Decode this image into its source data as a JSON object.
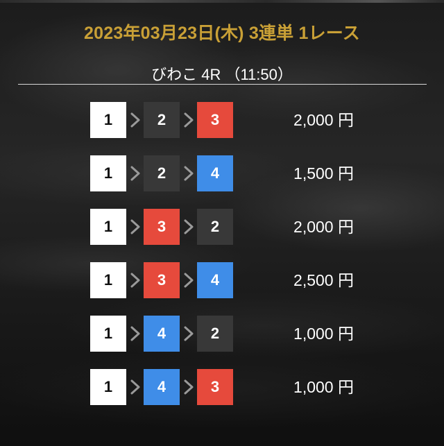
{
  "header": {
    "title": "2023年03月23日(木) 3連単 1レース",
    "race_info": "びわこ 4R （11:50）"
  },
  "colors": {
    "title_gold": "#c9a036",
    "box_white": "#ffffff",
    "box_black": "#383838",
    "box_red": "#e64a3c",
    "box_blue": "#3f8de8"
  },
  "bets": [
    {
      "first": {
        "number": "1",
        "color": "white"
      },
      "second": {
        "number": "2",
        "color": "black"
      },
      "third": {
        "number": "3",
        "color": "red"
      },
      "amount": "2,000 円"
    },
    {
      "first": {
        "number": "1",
        "color": "white"
      },
      "second": {
        "number": "2",
        "color": "black"
      },
      "third": {
        "number": "4",
        "color": "blue"
      },
      "amount": "1,500 円"
    },
    {
      "first": {
        "number": "1",
        "color": "white"
      },
      "second": {
        "number": "3",
        "color": "red"
      },
      "third": {
        "number": "2",
        "color": "black"
      },
      "amount": "2,000 円"
    },
    {
      "first": {
        "number": "1",
        "color": "white"
      },
      "second": {
        "number": "3",
        "color": "red"
      },
      "third": {
        "number": "4",
        "color": "blue"
      },
      "amount": "2,500 円"
    },
    {
      "first": {
        "number": "1",
        "color": "white"
      },
      "second": {
        "number": "4",
        "color": "blue"
      },
      "third": {
        "number": "2",
        "color": "black"
      },
      "amount": "1,000 円"
    },
    {
      "first": {
        "number": "1",
        "color": "white"
      },
      "second": {
        "number": "4",
        "color": "blue"
      },
      "third": {
        "number": "3",
        "color": "red"
      },
      "amount": "1,000 円"
    }
  ]
}
